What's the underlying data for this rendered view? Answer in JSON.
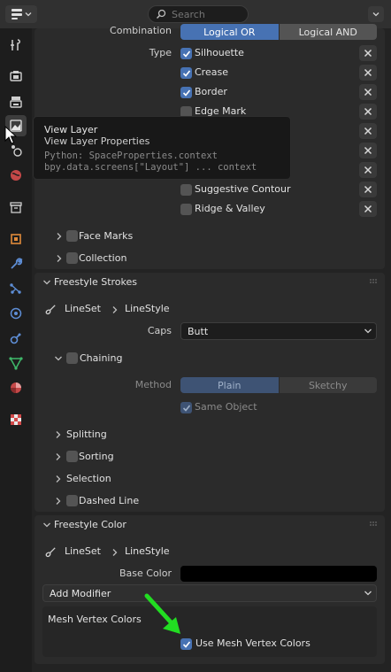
{
  "header": {
    "search_placeholder": "Search"
  },
  "tabs": [
    {
      "icon": "tool-icon",
      "active": false
    },
    {
      "icon": "render-icon",
      "active": false
    },
    {
      "icon": "output-icon",
      "active": false
    },
    {
      "icon": "view-layer-icon",
      "active": true
    },
    {
      "icon": "scene-icon",
      "active": false
    },
    {
      "icon": "world-icon",
      "active": false
    },
    {
      "icon": "collection-icon",
      "active": false
    },
    {
      "icon": "object-icon",
      "active": false
    },
    {
      "icon": "modifier-icon",
      "active": false
    },
    {
      "icon": "particles-icon",
      "active": false
    },
    {
      "icon": "physics-icon",
      "active": false
    },
    {
      "icon": "constraints-icon",
      "active": false
    },
    {
      "icon": "data-icon",
      "active": false
    },
    {
      "icon": "material-icon",
      "active": false
    },
    {
      "icon": "texture-icon",
      "active": false
    }
  ],
  "edge_types": {
    "combination_label": "Combination",
    "combination_options": [
      "Logical OR",
      "Logical AND"
    ],
    "combination_selected": "Logical OR",
    "type_label": "Type",
    "types": [
      {
        "label": "Silhouette",
        "checked": true
      },
      {
        "label": "Crease",
        "checked": true
      },
      {
        "label": "Border",
        "checked": true
      },
      {
        "label": "Edge Mark",
        "checked": false
      },
      {
        "label": "",
        "checked": false
      },
      {
        "label": "",
        "checked": false
      },
      {
        "label": "",
        "checked": false
      },
      {
        "label": "Suggestive Contour",
        "checked": false
      },
      {
        "label": "Ridge & Valley",
        "checked": false
      }
    ]
  },
  "subpanels_top": [
    {
      "label": "Face Marks",
      "has_checkbox": true
    },
    {
      "label": "Collection",
      "has_checkbox": true
    }
  ],
  "strokes": {
    "title": "Freestyle Strokes",
    "breadcrumb_a": "LineSet",
    "breadcrumb_b": "LineStyle",
    "caps_label": "Caps",
    "caps_value": "Butt",
    "chaining_label": "Chaining",
    "method_label": "Method",
    "method_options": [
      "Plain",
      "Sketchy"
    ],
    "method_selected": "Plain",
    "same_object_label": "Same Object",
    "subpanels": [
      {
        "label": "Splitting",
        "has_checkbox": false
      },
      {
        "label": "Sorting",
        "has_checkbox": true
      },
      {
        "label": "Selection",
        "has_checkbox": false
      },
      {
        "label": "Dashed Line",
        "has_checkbox": true
      }
    ]
  },
  "color": {
    "title": "Freestyle Color",
    "breadcrumb_a": "LineSet",
    "breadcrumb_b": "LineStyle",
    "base_color_label": "Base Color",
    "base_color_value": "#000000",
    "add_modifier_label": "Add Modifier",
    "mesh_vertex_colors_title": "Mesh Vertex Colors",
    "use_mesh_vertex_colors_label": "Use Mesh Vertex Colors",
    "use_mesh_vertex_colors": true
  },
  "tooltip": {
    "title": "View Layer",
    "subtitle": "View Layer Properties",
    "python_line1": "Python: SpaceProperties.context",
    "python_line2": "bpy.data.screens[\"Layout\"] ... context"
  },
  "colors": {
    "accent": "#4772b3",
    "panel": "#2b2b2b",
    "background": "#1d1d1d",
    "annotation_arrow": "#22dd22"
  }
}
